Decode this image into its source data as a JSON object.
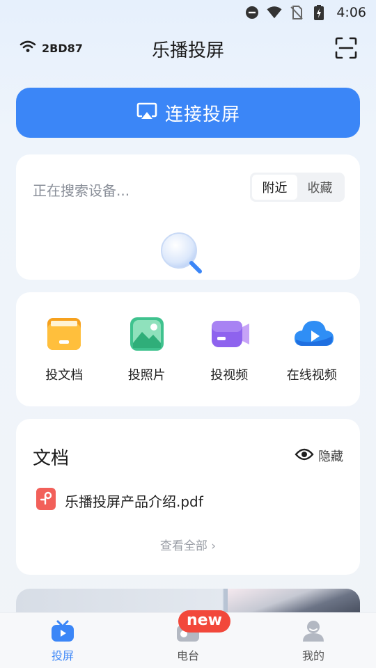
{
  "status_bar": {
    "time": "4:06"
  },
  "header": {
    "ssid": "2BD87",
    "title": "乐播投屏"
  },
  "connect": {
    "label": "连接投屏"
  },
  "search": {
    "status_text": "正在搜索设备...",
    "tabs": [
      {
        "label": "附近",
        "active": true
      },
      {
        "label": "收藏",
        "active": false
      }
    ]
  },
  "tools": [
    {
      "label": "投文档",
      "icon": "folder-icon"
    },
    {
      "label": "投照片",
      "icon": "photo-icon"
    },
    {
      "label": "投视频",
      "icon": "video-camera-icon"
    },
    {
      "label": "在线视频",
      "icon": "cloud-play-icon"
    }
  ],
  "docs": {
    "title": "文档",
    "hide_label": "隐藏",
    "files": [
      {
        "name": "乐播投屏产品介绍.pdf",
        "icon": "pdf-icon"
      }
    ],
    "view_all": "查看全部 ›"
  },
  "tabbar": {
    "items": [
      {
        "label": "投屏",
        "icon": "tv-icon",
        "active": true
      },
      {
        "label": "电台",
        "icon": "radio-icon",
        "active": false,
        "badge": "new"
      },
      {
        "label": "我的",
        "icon": "user-icon",
        "active": false
      }
    ]
  },
  "colors": {
    "accent": "#3b86f7",
    "badge": "#f2483b"
  }
}
